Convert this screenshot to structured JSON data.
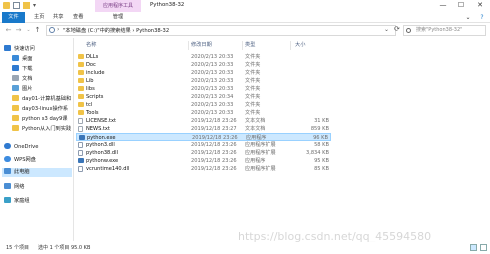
{
  "title_bar": {
    "context_tab_label": "应用程序工具",
    "window_title": "Python38-32",
    "minimize": "—",
    "maximize": "☐",
    "close": "✕"
  },
  "ribbon": {
    "tabs": [
      "文件",
      "主页",
      "共享",
      "查看"
    ],
    "manage": "管理"
  },
  "address": {
    "path": "\"本地磁盘 (C:)\"中的搜索结果 › Python38-32",
    "search_placeholder": "搜索\"Python38-32\""
  },
  "sidebar": {
    "items": [
      {
        "label": "快速访问",
        "icon": "star-icon",
        "color": "#2f7ad0"
      },
      {
        "label": "桌面",
        "icon": "desktop-icon",
        "color": "#3a8ad8"
      },
      {
        "label": "下载",
        "icon": "download-icon",
        "color": "#2f7ad0"
      },
      {
        "label": "文档",
        "icon": "document-icon",
        "color": "#9aa6b4"
      },
      {
        "label": "图片",
        "icon": "pictures-icon",
        "color": "#5aa0d8"
      },
      {
        "label": "day01-计算机基础和",
        "icon": "folder-icon",
        "color": "#f0c348"
      },
      {
        "label": "day03-linux操作系",
        "icon": "folder-icon",
        "color": "#f0c348"
      },
      {
        "label": "python s3 day9课",
        "icon": "folder-icon",
        "color": "#f0c348"
      },
      {
        "label": "Python从入门到实践",
        "icon": "folder-icon",
        "color": "#f0c348"
      },
      {
        "label": "OneDrive",
        "icon": "cloud-icon",
        "color": "#2f7ad0"
      },
      {
        "label": "WPS网盘",
        "icon": "cloud-icon",
        "color": "#3d8ce0"
      },
      {
        "label": "此电脑",
        "icon": "computer-icon",
        "color": "#4a8ed4"
      },
      {
        "label": "网络",
        "icon": "network-icon",
        "color": "#4a8ed4"
      },
      {
        "label": "家庭组",
        "icon": "homegroup-icon",
        "color": "#3aa0c8"
      }
    ]
  },
  "columns": {
    "name": "名称",
    "date": "修改日期",
    "type": "类型",
    "size": "大小"
  },
  "files": [
    {
      "name": "DLLs",
      "date": "2020/2/13 20:33",
      "type": "文件夹",
      "size": "",
      "kind": "folder"
    },
    {
      "name": "Doc",
      "date": "2020/2/13 20:33",
      "type": "文件夹",
      "size": "",
      "kind": "folder"
    },
    {
      "name": "include",
      "date": "2020/2/13 20:33",
      "type": "文件夹",
      "size": "",
      "kind": "folder"
    },
    {
      "name": "Lib",
      "date": "2020/2/13 20:33",
      "type": "文件夹",
      "size": "",
      "kind": "folder"
    },
    {
      "name": "libs",
      "date": "2020/2/13 20:33",
      "type": "文件夹",
      "size": "",
      "kind": "folder"
    },
    {
      "name": "Scripts",
      "date": "2020/2/13 20:34",
      "type": "文件夹",
      "size": "",
      "kind": "folder"
    },
    {
      "name": "tcl",
      "date": "2020/2/13 20:33",
      "type": "文件夹",
      "size": "",
      "kind": "folder"
    },
    {
      "name": "Tools",
      "date": "2020/2/13 20:33",
      "type": "文件夹",
      "size": "",
      "kind": "folder"
    },
    {
      "name": "LICENSE.txt",
      "date": "2019/12/18 23:26",
      "type": "文本文档",
      "size": "31 KB",
      "kind": "file"
    },
    {
      "name": "NEWS.txt",
      "date": "2019/12/18 23:27",
      "type": "文本文档",
      "size": "859 KB",
      "kind": "file"
    },
    {
      "name": "python.exe",
      "date": "2019/12/18 23:26",
      "type": "应用程序",
      "size": "96 KB",
      "kind": "exe",
      "selected": true
    },
    {
      "name": "python3.dll",
      "date": "2019/12/18 23:26",
      "type": "应用程序扩展",
      "size": "58 KB",
      "kind": "dll"
    },
    {
      "name": "python38.dll",
      "date": "2019/12/18 23:26",
      "type": "应用程序扩展",
      "size": "3,834 KB",
      "kind": "dll"
    },
    {
      "name": "pythonw.exe",
      "date": "2019/12/18 23:26",
      "type": "应用程序",
      "size": "95 KB",
      "kind": "exe"
    },
    {
      "name": "vcruntime140.dll",
      "date": "2019/12/18 23:26",
      "type": "应用程序扩展",
      "size": "85 KB",
      "kind": "dll"
    }
  ],
  "status": {
    "count": "15 个项目",
    "selection": "选中 1 个项目 95.0 KB"
  },
  "watermark": "https://blog.csdn.net/qq_45594580"
}
